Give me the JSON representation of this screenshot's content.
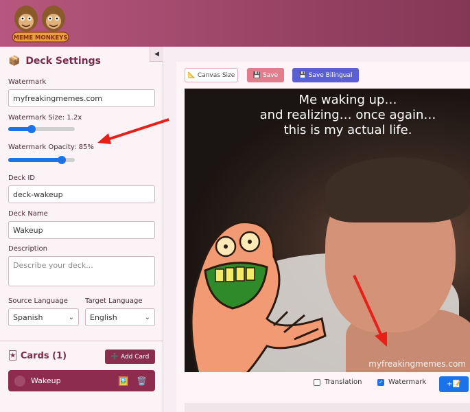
{
  "app": {
    "logo_text": "MEME MONKEYS",
    "collapse_glyph": "◀",
    "colors": {
      "accent": "#8a2d4f",
      "primary_blue": "#1a73e8",
      "save": "#e27d8e",
      "bilingual": "#5a5fd6"
    }
  },
  "sidebar": {
    "title_icon": "📦",
    "title": "Deck Settings",
    "watermark_label": "Watermark",
    "watermark_value": "myfreakingmemes.com",
    "watermark_size_label": "Watermark Size: 1.2x",
    "watermark_size_fraction": 0.33,
    "watermark_opacity_label": "Watermark Opacity: 85%",
    "watermark_opacity_fraction": 0.85,
    "deck_id_label": "Deck ID",
    "deck_id_value": "deck-wakeup",
    "deck_name_label": "Deck Name",
    "deck_name_value": "Wakeup",
    "description_label": "Description",
    "description_placeholder": "Describe your deck...",
    "source_language_label": "Source Language",
    "source_language_value": "Spanish",
    "target_language_label": "Target Language",
    "target_language_value": "English",
    "cards_icon": "🃏",
    "cards_title": "Cards (1)",
    "add_card_icon": "➕",
    "add_card_label": "Add Card",
    "cards": [
      {
        "name": "Wakeup",
        "image_icon": "🖼️",
        "delete_icon": "🗑️"
      }
    ]
  },
  "toolbar": {
    "canvas_icon": "📐",
    "canvas_label": "Canvas Size",
    "save_icon": "💾",
    "save_label": "Save",
    "bilingual_icon": "💾",
    "bilingual_label": "Save Bilingual"
  },
  "meme": {
    "caption_lines": [
      "Me waking up…",
      "and realizing… once again…",
      "this is my actual life."
    ],
    "watermark": "myfreakingmemes.com"
  },
  "options": {
    "translation_label": "Translation",
    "translation_checked": false,
    "watermark_label": "Watermark",
    "watermark_checked": true,
    "edit_button_label": "+📝"
  }
}
